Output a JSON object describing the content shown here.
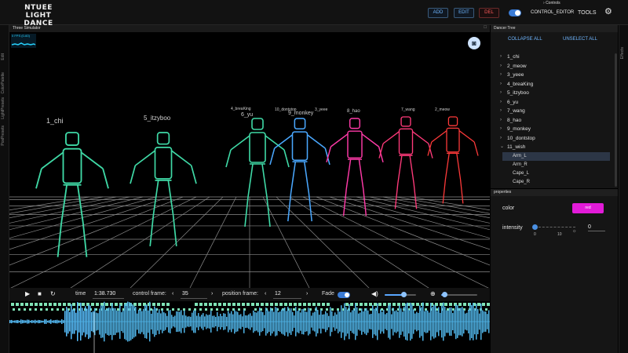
{
  "app": {
    "logo_line1": "NTUEE",
    "logo_line2": "LIGHT DANCE"
  },
  "toolbar": {
    "controls_label": "Controls",
    "add_label": "ADD",
    "edit_label": "EDIT",
    "del_label": "DEL",
    "mode_label": "CONTROL_EDITOR",
    "mode_on": true,
    "tools_label": "TOOLS",
    "settings_icon": "gear-icon"
  },
  "left_tabs": [
    "Edit",
    "ColorPalette",
    "LightPresets",
    "PosPresets"
  ],
  "right_tabs": [
    "Effects"
  ],
  "simulator": {
    "title": "Three Simulator",
    "fps_text": "0 FPS (0-60)",
    "camera_icon": "camera-icon",
    "dancers": [
      {
        "name": "1_chi",
        "color": "#3fd9a6"
      },
      {
        "name": "5_itzyboo",
        "color": "#3fd9a6"
      },
      {
        "name": "4_breaKing",
        "color": "#3fd9a6"
      },
      {
        "name": "6_yu",
        "color": "#3fd9a6"
      },
      {
        "name": "10_dontstop",
        "color": "#4aa8ff"
      },
      {
        "name": "9_monkey",
        "color": "#4aa8ff"
      },
      {
        "name": "3_yeee",
        "color": "#ff3aa8"
      },
      {
        "name": "8_hao",
        "color": "#ff3aa8"
      },
      {
        "name": "7_wang",
        "color": "#ff3a7a"
      },
      {
        "name": "2_meow",
        "color": "#ff3a3a"
      }
    ]
  },
  "transport": {
    "time_label": "time",
    "time_value": "1:38.730",
    "control_frame_label": "control frame:",
    "control_frame_value": "35",
    "position_frame_label": "position frame:",
    "position_frame_value": "12",
    "fade_label": "Fade",
    "fade_on": true,
    "volume_level": 0.6,
    "zoom_level": 0.1
  },
  "dancer_tree": {
    "title": "Dancer Tree",
    "collapse_label": "COLLAPSE ALL",
    "unselect_label": "UNSELECT ALL",
    "items": [
      {
        "label": "1_chi",
        "expanded": false
      },
      {
        "label": "2_meow",
        "expanded": false
      },
      {
        "label": "3_yeee",
        "expanded": false
      },
      {
        "label": "4_breaKing",
        "expanded": false
      },
      {
        "label": "5_itzyboo",
        "expanded": false
      },
      {
        "label": "6_yu",
        "expanded": false
      },
      {
        "label": "7_wang",
        "expanded": false
      },
      {
        "label": "8_hao",
        "expanded": false
      },
      {
        "label": "9_monkey",
        "expanded": false
      },
      {
        "label": "10_dontstop",
        "expanded": false
      },
      {
        "label": "11_wish",
        "expanded": true
      }
    ],
    "children": [
      {
        "label": "Arm_L",
        "selected": true
      },
      {
        "label": "Arm_R",
        "selected": false
      },
      {
        "label": "Cape_L",
        "selected": false
      },
      {
        "label": "Cape_R",
        "selected": false
      }
    ]
  },
  "properties": {
    "title": "properties",
    "color_label": "color",
    "color_value": "red",
    "color_hex": "#e21bd8",
    "intensity_label": "intensity",
    "intensity_min": "0",
    "intensity_max": "10",
    "intensity_value": "0"
  }
}
